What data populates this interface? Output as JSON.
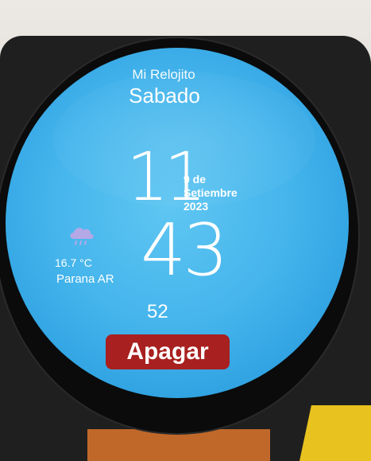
{
  "watch": {
    "brand": "Mi Relojito",
    "day": "Sabado",
    "time": {
      "hours": "11",
      "minutes": "43",
      "seconds": "52"
    },
    "date": {
      "day_line": "9 de",
      "month": "Setiembre",
      "year": "2023"
    },
    "weather": {
      "icon": "cloud-rain-icon",
      "temperature": "16.7 °C",
      "location": "Parana AR"
    },
    "off_button_label": "Apagar"
  },
  "colors": {
    "face_blue": "#45b5ec",
    "button_red": "#a8201f",
    "text": "#ffffff",
    "icon_lavender": "#b5a8e6"
  }
}
